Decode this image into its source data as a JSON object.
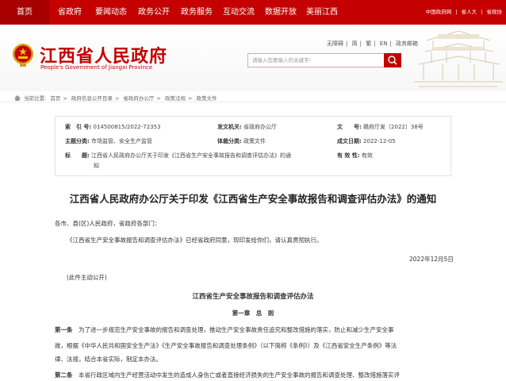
{
  "topnav": {
    "items": [
      "首页",
      "省政府",
      "要闻动态",
      "政务公开",
      "政务服务",
      "互动交流",
      "数据开放",
      "美丽江西"
    ],
    "right_links": [
      "中国政府网",
      "省人大",
      "省政协"
    ]
  },
  "header": {
    "title": "江西省人民政府",
    "subtitle": "People's Government of Jiangxi Province",
    "links": [
      "无障碍",
      "简",
      "繁",
      "EN",
      "政务邮箱"
    ],
    "search_placeholder": "请输入您要输入的关键字!"
  },
  "breadcrumb": {
    "label": "当前位置:",
    "items": [
      "首页",
      "政府信息公开目录",
      "省政府办公厅",
      "政策法规",
      "政策文件"
    ]
  },
  "meta": {
    "index_label": "索　引 号:",
    "index_value": "014500815/2022-72353",
    "issuer_label": "发文机关:",
    "issuer_value": "省政府办公厅",
    "docno_label": "文　　号:",
    "docno_value": "赣府厅发〔2022〕38号",
    "topic_label": "主题分类:",
    "topic_value": "市场监管、安全生产监管",
    "genre_label": "体裁分类:",
    "genre_value": "政策文件",
    "date_label": "成文日期:",
    "date_value": "2022-12-05",
    "title_label": "标　　题:",
    "title_line1": "江西省人民政府办公厅关于印发《江西省生产安全事故报告和调查评估办法》的通",
    "title_line2": "知",
    "validity_label": "有 效 性:",
    "validity_value": "有效"
  },
  "article": {
    "title": "江西省人民政府办公厅关于印发《江西省生产安全事故报告和调查评估办法》的通知",
    "salutation": "各市、县(区)人民政府，省政府各部门：",
    "body": "《江西省生产安全事故报告和调查评估办法》已经省政府同意，现印发给你们，请认真贯彻执行。",
    "date": "2022年12月5日",
    "note": "(此件主动公开)",
    "doc_title": "江西省生产安全事故报告和调查评估办法",
    "chapter": "第一章　总　则",
    "art1_label": "第一条",
    "art1_l1": "为了进一步规范生产安全事故的报告和调查处理，推动生产安全事故责任追究和整改措施的落实，防止和减少生产安全事",
    "art1_l2": "故，根据《中华人民共和国安全生产法》《生产安全事故报告和调查处理条例》（以下简称《条例》）及《江西省安全生产条例》等法",
    "art1_l3": "律、法规，结合本省实际，制定本办法。",
    "art2_label": "第二条",
    "art2_l1": "本省行政区域内生产经营活动中发生的造成人身伤亡或者直接经济损失的生产安全事故的报告和调查处理、整改措施落实评"
  }
}
